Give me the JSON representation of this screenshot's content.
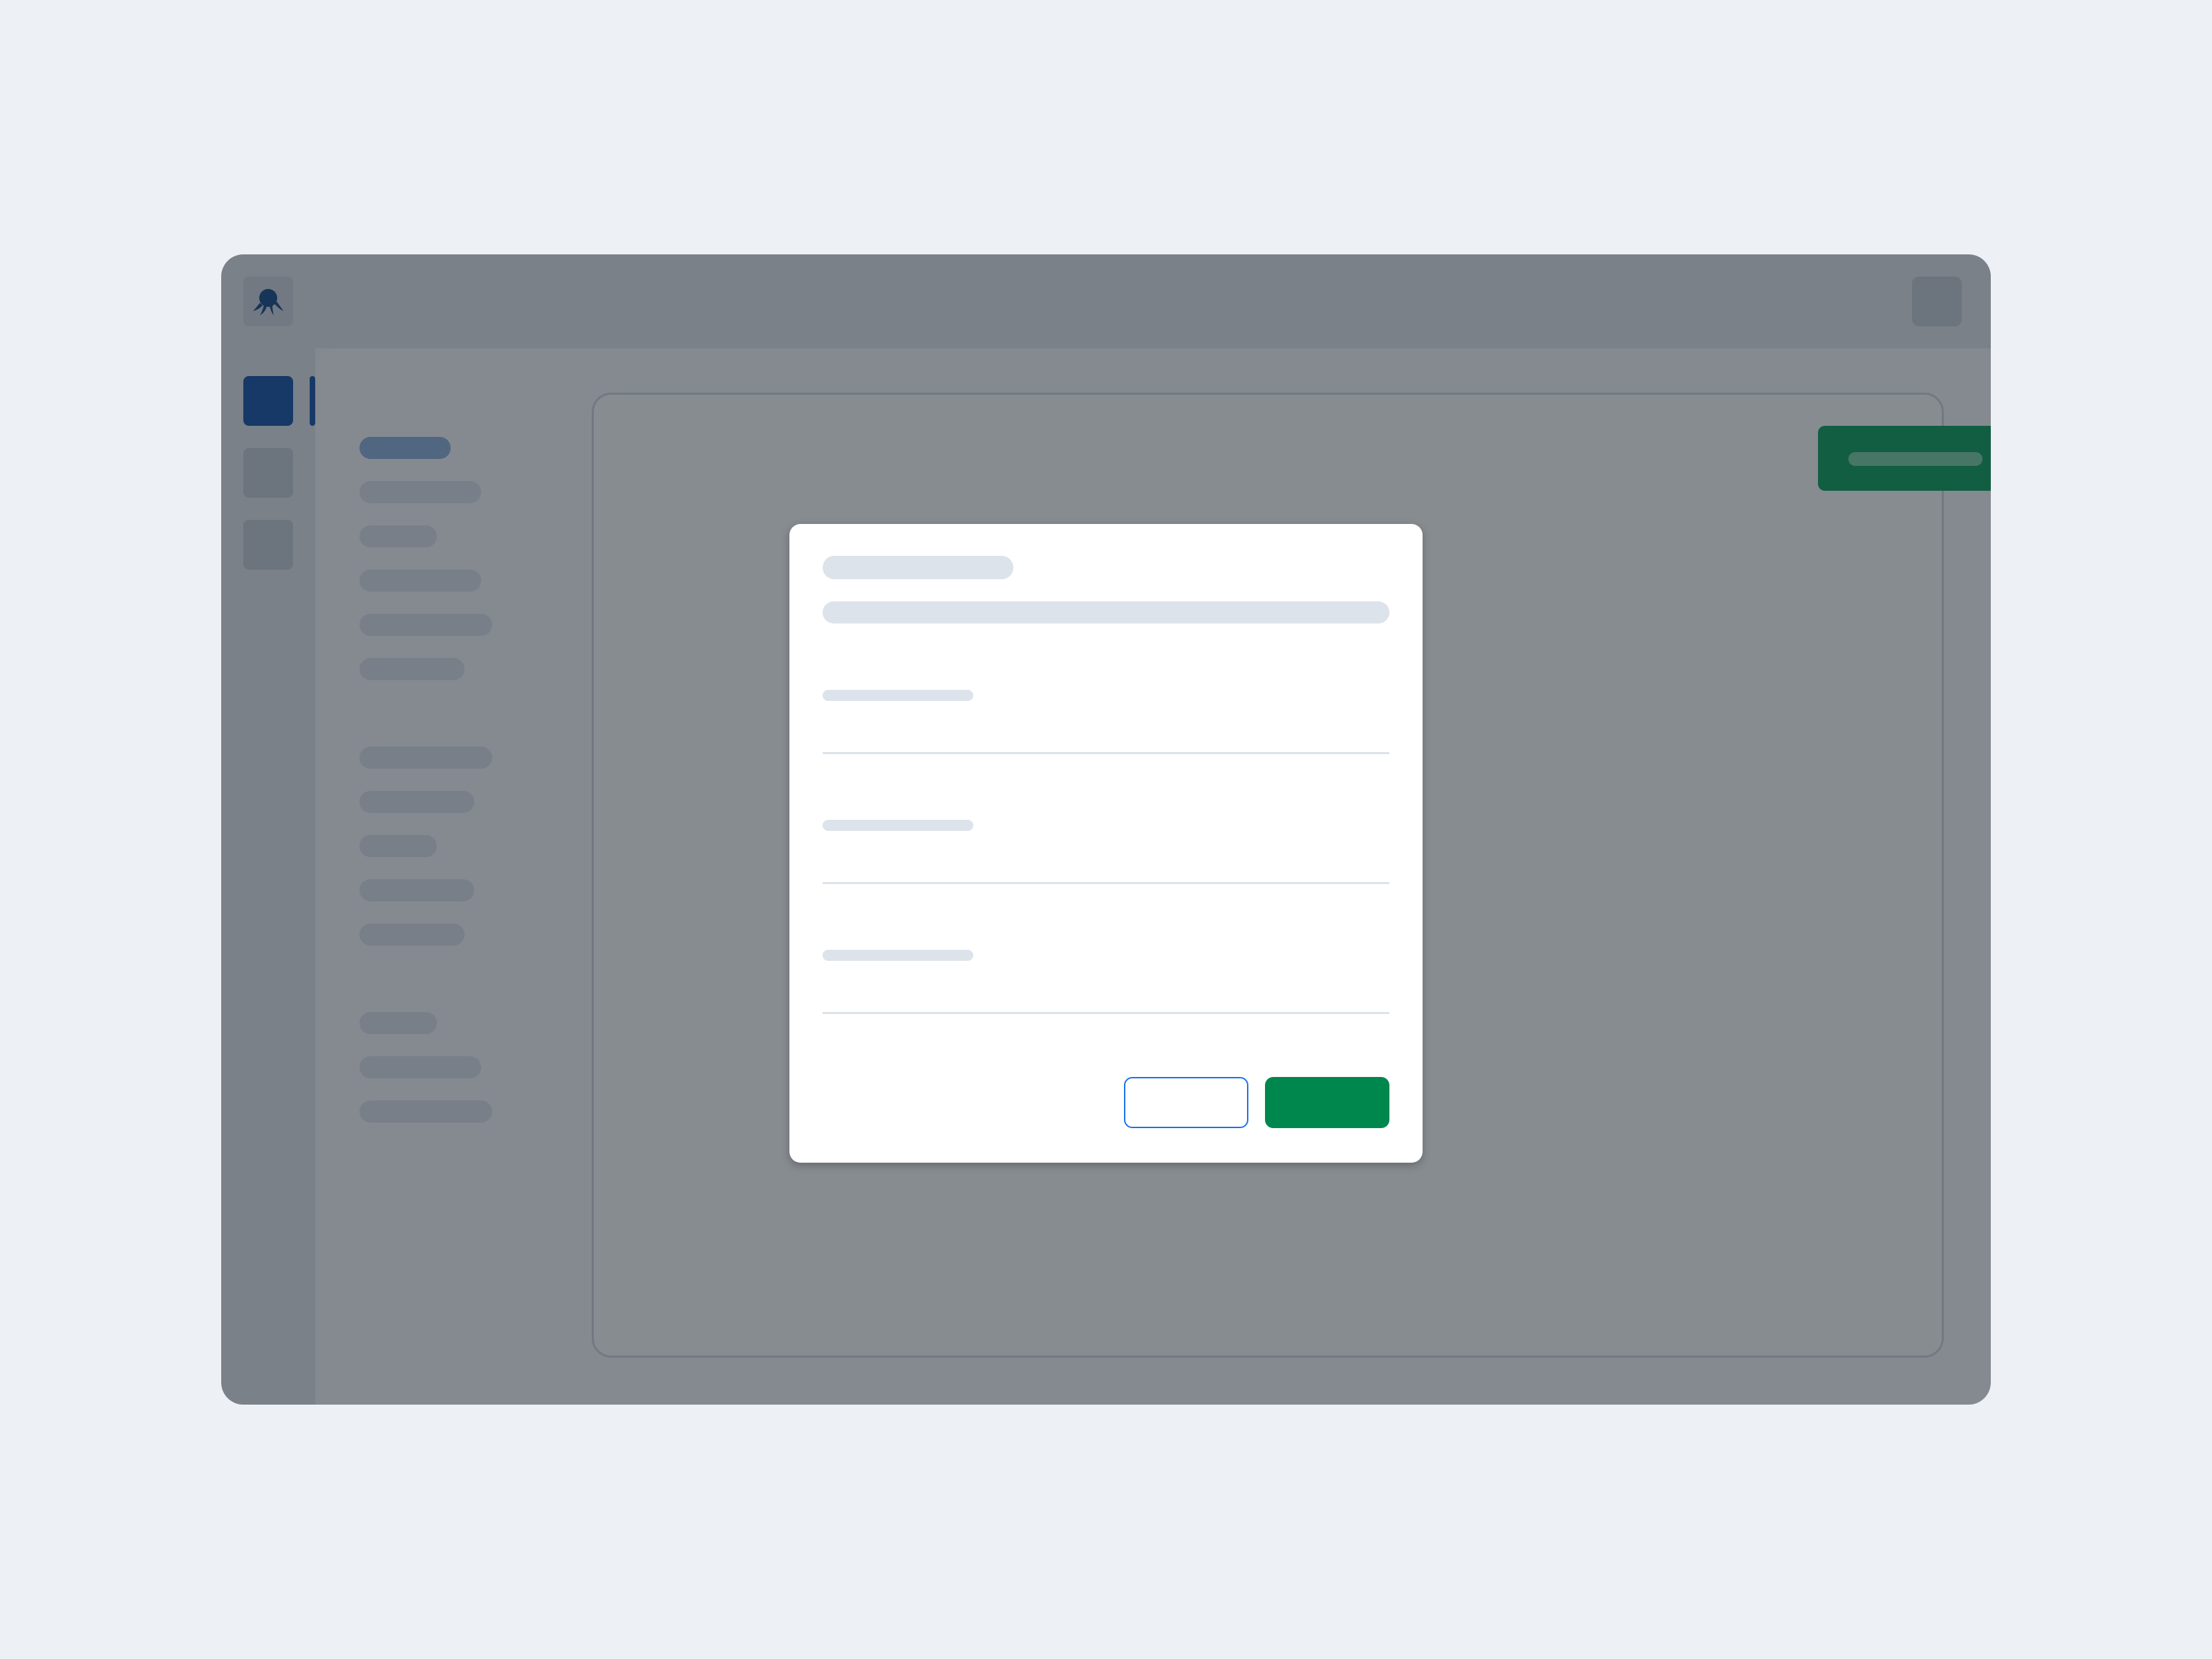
{
  "app": {
    "logo_icon": "octopus-logo-icon",
    "accent_color": "#1a56a8",
    "primary_action_color": "#11a060"
  },
  "rail": {
    "items": [
      {
        "icon": "nav-icon",
        "active": true
      },
      {
        "icon": "nav-icon",
        "active": false
      },
      {
        "icon": "nav-icon",
        "active": false
      }
    ],
    "avatar_icon": "user-avatar"
  },
  "dialog": {
    "title": "",
    "description": "",
    "fields": [
      {
        "label": "",
        "value": ""
      },
      {
        "label": "",
        "value": ""
      },
      {
        "label": "",
        "value": ""
      }
    ],
    "cancel_label": "",
    "confirm_label": "",
    "cancel_border_color": "#1a73e8",
    "confirm_color": "#00874d"
  }
}
